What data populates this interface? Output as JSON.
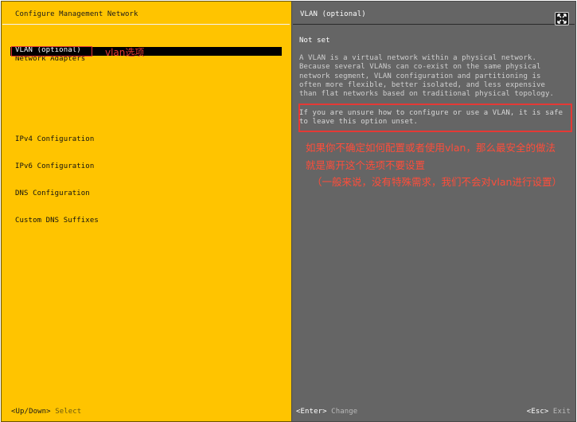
{
  "left": {
    "title": "Configure Management Network",
    "menu": [
      "Network Adapters",
      "VLAN (optional)",
      "",
      "IPv4 Configuration",
      "IPv6 Configuration",
      "DNS Configuration",
      "Custom DNS Suffixes"
    ],
    "selected_item": "VLAN (optional)",
    "annotation": "vlan选项",
    "footer": {
      "key": "<Up/Down>",
      "action": "Select"
    }
  },
  "right": {
    "title": "VLAN (optional)",
    "value": "Not set",
    "description": "A VLAN is a virtual network within a physical network.\nBecause several VLANs can co-exist on the same physical\nnetwork segment, VLAN configuration and partitioning is\noften more flexible, better isolated, and less expensive\nthan flat networks based on traditional physical topology.",
    "warning": "If you are unsure how to configure or use a VLAN, it is safe\nto leave this option unset.",
    "annotation": {
      "line1": "如果你不确定如何配置或者使用vlan，那么最安全的做法",
      "line2": "就是离开这个选项不要设置",
      "line3": "（一般来说，没有特殊需求，我们不会对vlan进行设置）"
    },
    "footer_left": {
      "key": "<Enter>",
      "action": "Change"
    },
    "footer_right": {
      "key": "<Esc>",
      "action": "Exit"
    }
  },
  "colors": {
    "left_bg": "#ffc400",
    "right_bg": "#656565",
    "annotation": "#e53935",
    "selection": "#000000"
  },
  "icons": {
    "close": "close-expand-icon"
  }
}
